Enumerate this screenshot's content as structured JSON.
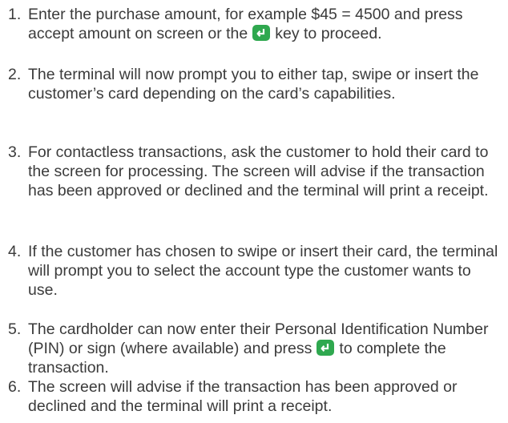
{
  "steps": [
    {
      "number": "1.",
      "text_a": "Enter the purchase amount, for example $45 = 4500 and press accept amount on screen or the",
      "key_icon": "enter-key-icon",
      "text_b": "key to proceed."
    },
    {
      "number": "2.",
      "text": "The terminal will now prompt you to either tap, swipe or insert the customer’s card depending on the card’s capabilities."
    },
    {
      "number": "3.",
      "text": "For contactless transactions, ask the customer to hold their card to the screen for processing. The screen will advise if the transaction has been approved or declined and the terminal will print a receipt."
    },
    {
      "number": "4.",
      "text": "If the customer has chosen to swipe or insert their card, the terminal will prompt you to select the account type the customer wants to use."
    },
    {
      "number": "5.",
      "text_a": "The cardholder can now enter their Personal Identification Number (PIN) or sign (where available) and press",
      "key_icon": "enter-key-icon",
      "text_b": "to complete the transaction."
    },
    {
      "number": "6.",
      "text": "The screen will advise if the transaction has been approved or declined and the terminal will print a receipt."
    }
  ],
  "colors": {
    "text": "#3b3b3b",
    "enter_key": "#2fa84f"
  }
}
